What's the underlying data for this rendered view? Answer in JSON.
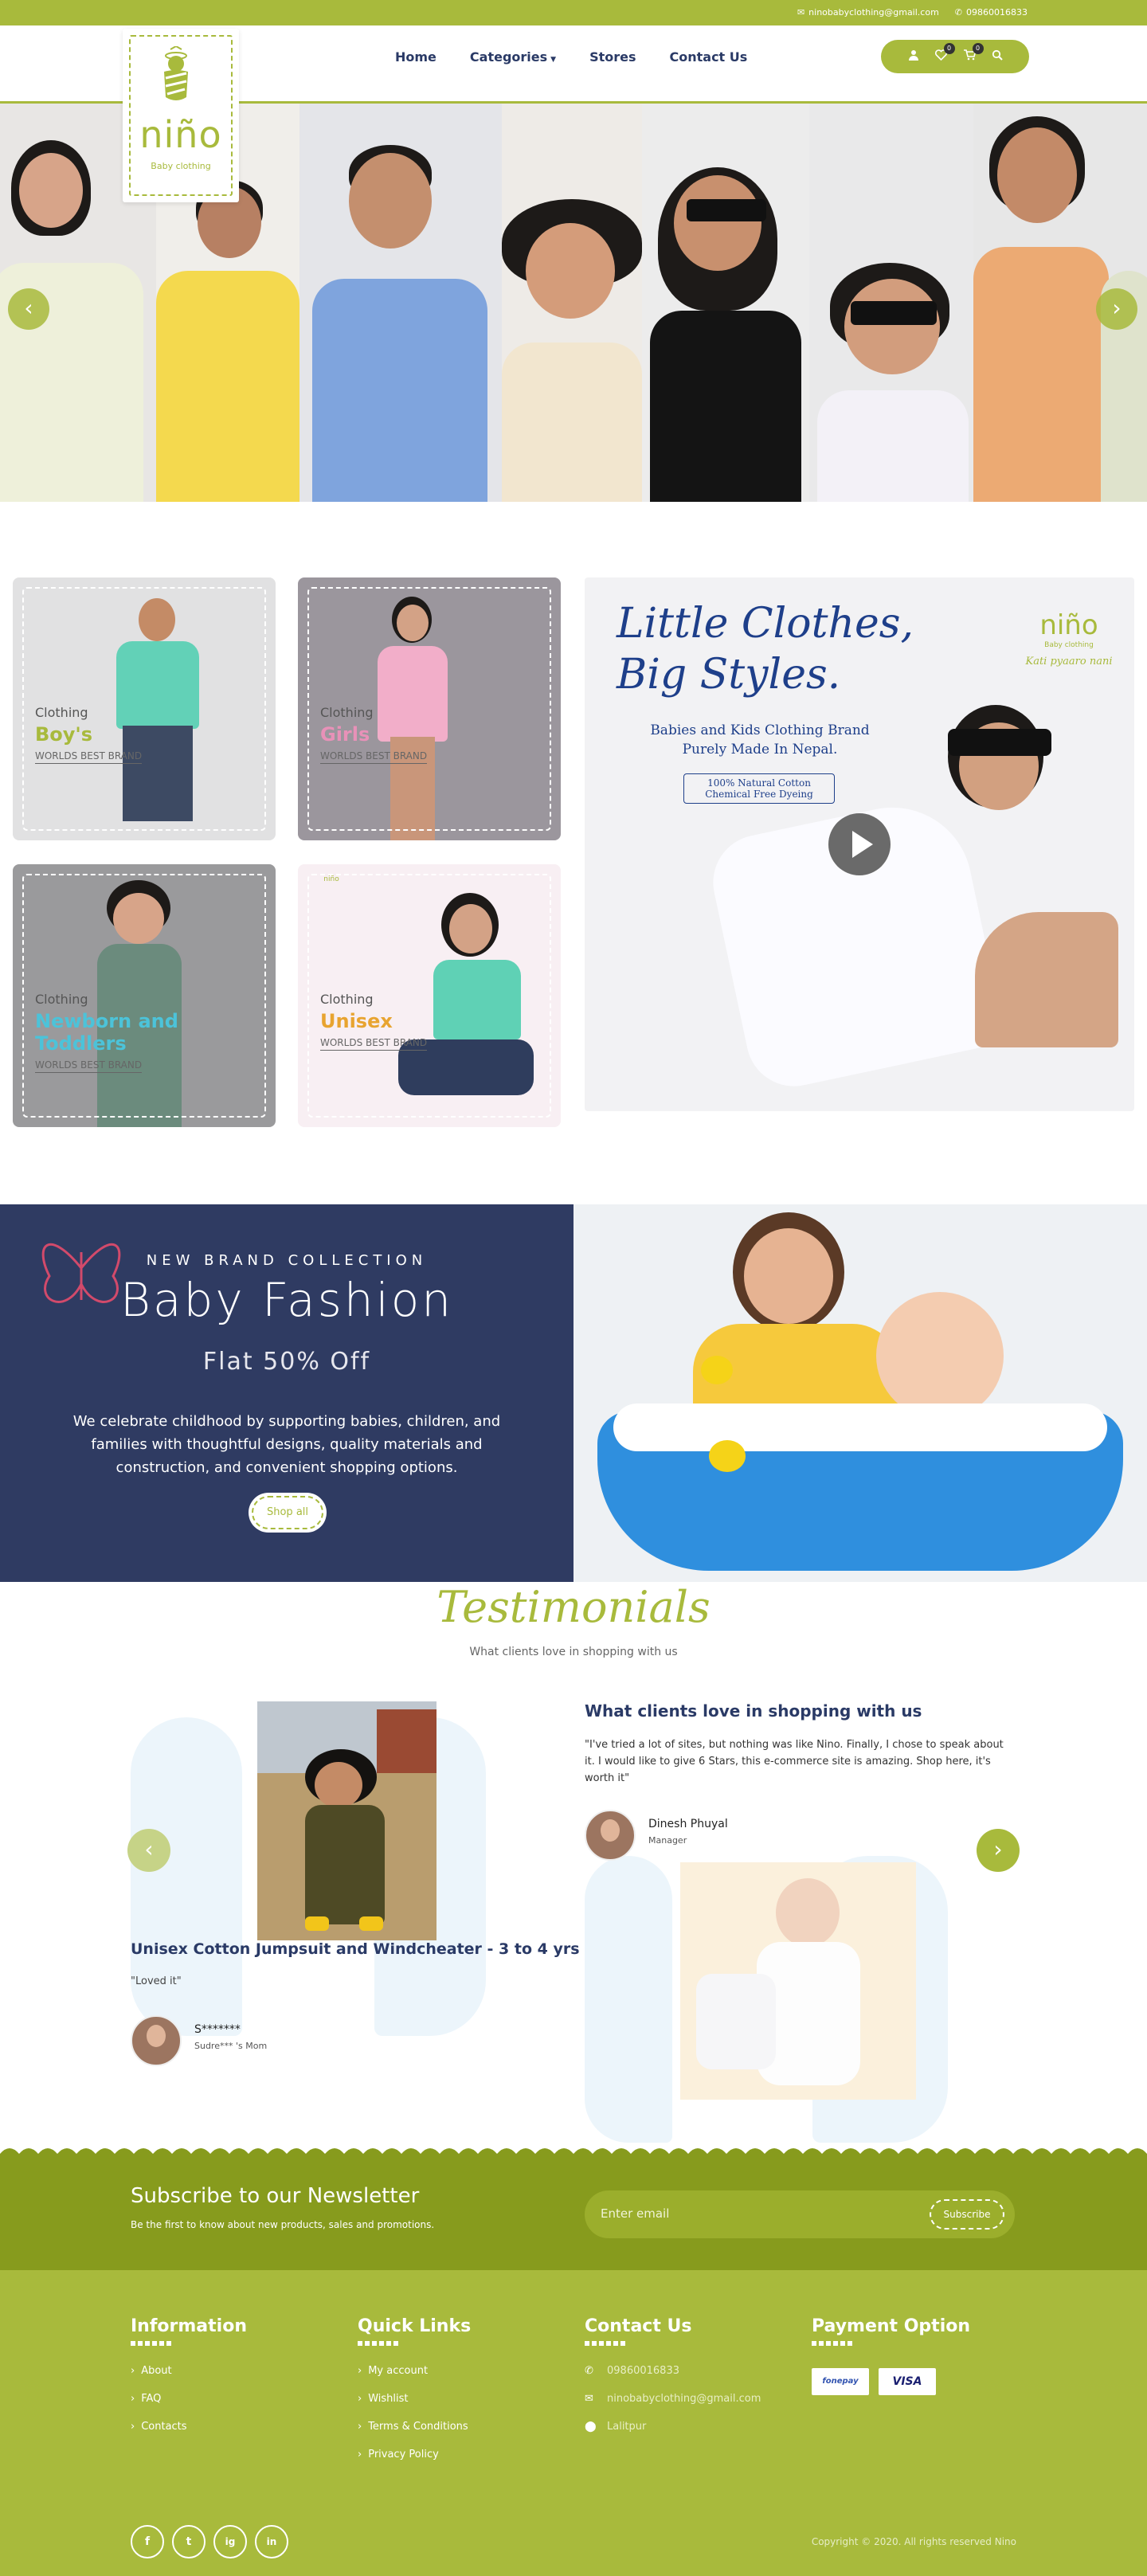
{
  "topbar": {
    "email": "ninobabyclothing@gmail.com",
    "phone": "09860016833"
  },
  "brand": {
    "name": "niño",
    "tagline": "Baby clothing"
  },
  "nav": {
    "home": "Home",
    "categories": "Categories",
    "stores": "Stores",
    "contact": "Contact Us"
  },
  "header_icons": {
    "wishlist_count": "0",
    "cart_count": "0"
  },
  "hero": {
    "prev": "‹",
    "next": "›"
  },
  "categories": [
    {
      "label": "Clothing",
      "name": "Boy's",
      "sub": "WORLDS BEST BRAND",
      "color": "#a8ba3c"
    },
    {
      "label": "Clothing",
      "name": "Girls",
      "sub": "WORLDS BEST BRAND",
      "color": "#e891b8"
    },
    {
      "label": "Clothing",
      "name": "Newborn and Toddlers",
      "sub": "WORLDS BEST BRAND",
      "color": "#4cc3d9"
    },
    {
      "label": "Clothing",
      "name": "Unisex",
      "sub": "WORLDS BEST BRAND",
      "color": "#e8a430"
    }
  ],
  "promo": {
    "line1": "Little Clothes,",
    "line2": "Big Styles.",
    "desc": "Babies and Kids Clothing Brand Purely Made In Nepal.",
    "badge": "100% Natural Cotton Chemical Free Dyeing",
    "logo": "niño",
    "logo_sub": "Baby clothing",
    "logo_tag": "Kati pyaaro nani"
  },
  "fashion": {
    "kicker": "NEW BRAND COLLECTION",
    "title": "Baby Fashion",
    "offer": "Flat 50% Off",
    "desc": "We celebrate childhood by supporting babies, children, and families with thoughtful designs, quality materials and construction, and convenient shopping options.",
    "button": "Shop all"
  },
  "testimonials": {
    "title": "Testimonials",
    "subtitle": "What clients love in shopping with us",
    "product": "Unisex Cotton Jumpsuit and Windcheater - 3 to 4 yrs",
    "review1": "\"Loved it\"",
    "name1": "S*******",
    "role1": "Sudre*** 's Mom",
    "heading2": "What clients love in shopping with us",
    "review2": "\"I've tried a lot of sites, but nothing was like Nino. Finally, I chose to speak about it. I would like to give 6 Stars, this e-commerce site is amazing. Shop here, it's worth it\"",
    "name2": "Dinesh Phuyal",
    "role2": "Manager",
    "prev": "‹",
    "next": "›"
  },
  "newsletter": {
    "title": "Subscribe to our Newsletter",
    "subtitle": "Be the first to know about new products, sales and promotions.",
    "placeholder": "Enter email",
    "button": "Subscribe"
  },
  "footer": {
    "info_title": "Information",
    "info": [
      "About",
      "FAQ",
      "Contacts"
    ],
    "links_title": "Quick Links",
    "links": [
      "My account",
      "Wishlist",
      "Terms & Conditions",
      "Privacy Policy"
    ],
    "contact_title": "Contact Us",
    "phone": "09860016833",
    "email": "ninobabyclothing@gmail.com",
    "location": "Lalitpur",
    "pay_title": "Payment Option",
    "pay1": "fonepay",
    "pay2": "VISA",
    "social": [
      "f",
      "t",
      "ig",
      "in"
    ],
    "copyright": "Copyright © 2020. All rights reserved Nino"
  }
}
